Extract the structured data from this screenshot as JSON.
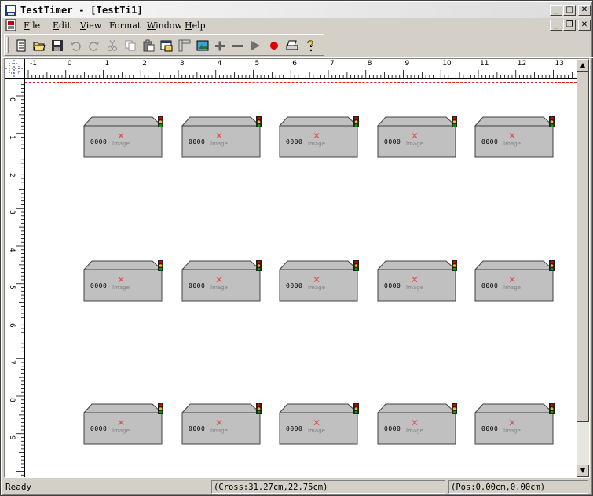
{
  "window": {
    "title": "TestTimer - [TestTi1]"
  },
  "menu": [
    {
      "label": "File",
      "underline": "F",
      "rest": "ile"
    },
    {
      "label": "Edit",
      "underline": "E",
      "rest": "dit"
    },
    {
      "label": "View",
      "underline": "V",
      "rest": "iew"
    },
    {
      "label": "Format",
      "underline": "",
      "rest": "Format"
    },
    {
      "label": "Window",
      "underline": "W",
      "rest": "indow"
    },
    {
      "label": "Help",
      "underline": "H",
      "rest": "elp"
    }
  ],
  "toolbar": [
    "new-icon",
    "open-icon",
    "save-icon",
    "undo-icon",
    "redo-icon",
    "cut-icon",
    "copy-icon",
    "paste-icon",
    "properties-icon",
    "ruler-icon",
    "picture-icon",
    "zoom-in-icon",
    "zoom-out-icon",
    "play-icon",
    "record-icon",
    "print-icon",
    "help-icon"
  ],
  "ruler": {
    "horizontal": [
      "-1",
      "0",
      "1",
      "2",
      "3",
      "4",
      "5",
      "6",
      "7",
      "8",
      "9",
      "10",
      "11",
      "12",
      "13"
    ],
    "vertical": [
      "0",
      "1",
      "2",
      "3",
      "4",
      "5",
      "6",
      "7",
      "8",
      "9"
    ]
  },
  "device": {
    "digits": "0000",
    "image_label": "Image"
  },
  "status": {
    "ready": "Ready",
    "cross": "(Cross:31.27cm,22.75cm)",
    "pos": "(Pos:0.00cm,0.00cm)"
  },
  "colors": {
    "device_body": "#c0c0c0",
    "page_line": "#e02020",
    "light_red": "#e00000",
    "light_yellow": "#f0c000",
    "light_green": "#00a000"
  }
}
